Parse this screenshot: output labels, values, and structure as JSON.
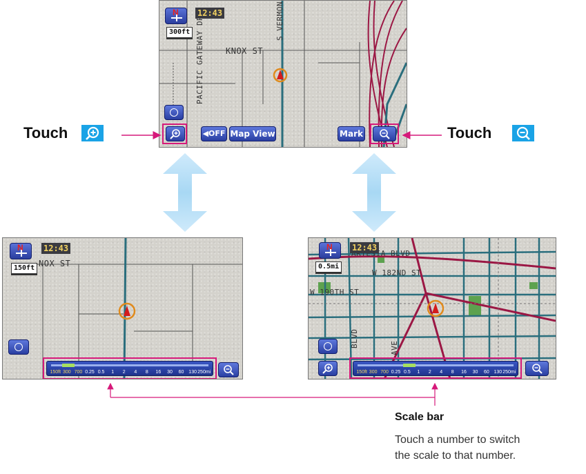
{
  "touch_label": "Touch",
  "top_map": {
    "clock": "12:43",
    "scale": "300ft",
    "streets": [
      "KNOX ST",
      "PACIFIC GATEWAY DR",
      "S VERMON"
    ],
    "buttons": {
      "zoom_in_icon": "zoom-in-icon",
      "off_label": "OFF",
      "map_view_label": "Map View",
      "mark_label": "Mark",
      "zoom_out_icon": "zoom-out-icon"
    }
  },
  "left_map": {
    "clock": "12:43",
    "scale": "150ft",
    "streets": [
      "NOX ST"
    ]
  },
  "right_map": {
    "clock": "12:43",
    "scale": "0.5mi",
    "streets": [
      "ARTESIA BLVD",
      "W 182ND ST",
      "W 190TH ST",
      "BLVD",
      "AVE"
    ]
  },
  "scale_levels": [
    "150ft",
    "300",
    "700",
    "0.25",
    "0.5",
    "1",
    "2",
    "4",
    "8",
    "16",
    "30",
    "60",
    "130",
    "250mi"
  ],
  "left_active_levels": [
    "150ft",
    "300",
    "700"
  ],
  "right_active_levels": [
    "150ft",
    "300",
    "700"
  ],
  "left_level_fraction": 0.08,
  "right_level_fraction": 0.33,
  "caption": {
    "title": "Scale bar",
    "line1": "Touch a number to switch",
    "line2": "the scale to that number."
  },
  "colors": {
    "highlight": "#d6197a",
    "arrow": "#a8d8f4",
    "road_major": "#2a6e7d",
    "freeway": "#9b1744",
    "park": "#5da24f"
  }
}
